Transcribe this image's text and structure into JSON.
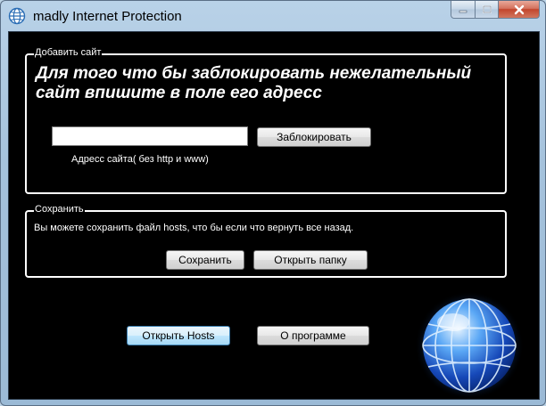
{
  "window": {
    "title": "madly Internet Protection",
    "icons": {
      "app": "globe-icon",
      "minimize": "minimize-icon",
      "maximize": "maximize-icon",
      "close": "close-icon"
    }
  },
  "add_site_group": {
    "legend": "Добавить сайт",
    "headline": "Для того что бы заблокировать нежелательный сайт впишите в поле его адресс",
    "url_input_value": "",
    "url_input_placeholder": "",
    "hint": "Адресс сайта( без http и www)",
    "block_button": "Заблокировать"
  },
  "save_group": {
    "legend": "Сохранить",
    "description": "Вы можете сохранить файл hosts, что бы если что вернуть все назад.",
    "save_button": "Сохранить",
    "open_folder_button": "Открыть папку"
  },
  "footer": {
    "open_hosts_button": "Открыть Hosts",
    "about_button": "О программе"
  },
  "colors": {
    "background": "#000000",
    "text": "#ffffff",
    "window_frame": "#a5c2dc",
    "close_button": "#c2452c",
    "focused_button": "#bee6fd"
  }
}
